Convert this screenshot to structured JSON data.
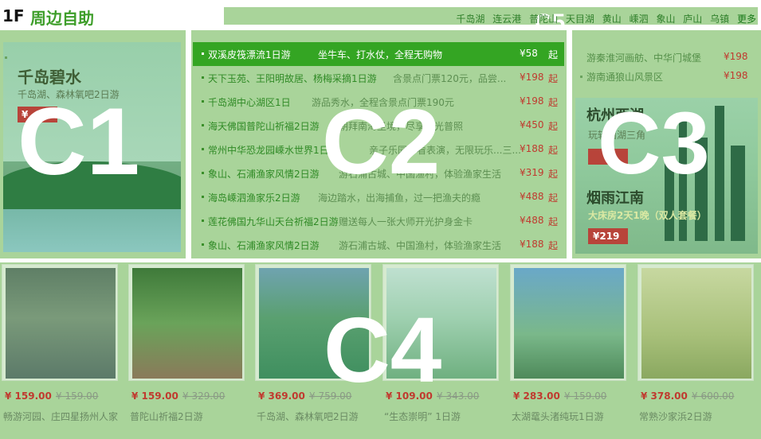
{
  "header": {
    "floor": "1F",
    "title": "周边自助",
    "c5_label": "C5",
    "links": [
      "千岛湖",
      "连云港",
      "普陀山",
      "天目湖",
      "黄山",
      "嵊泗",
      "象山",
      "庐山",
      "乌镇"
    ],
    "more": "更多"
  },
  "labels": {
    "c1": "C1",
    "c2": "C2",
    "c3": "C3",
    "c4": "C4"
  },
  "c1": {
    "title": "千岛碧水",
    "subtitle": "千岛湖、森林氧吧2日游",
    "price": "¥"
  },
  "c2": {
    "items": [
      {
        "name": "双溪皮筏漂流1日游",
        "desc": "坐牛车、打水仗，全程无购物",
        "price": "¥58",
        "qi": "起",
        "highlight": true
      },
      {
        "name": "天下玉苑、王阳明故居、杨梅采摘1日游",
        "desc": "含景点门票120元，品尝...",
        "price": "¥198",
        "qi": "起"
      },
      {
        "name": "千岛湖中心湖区1日",
        "desc": "游品秀水，全程含景点门票190元",
        "price": "¥198",
        "qi": "起"
      },
      {
        "name": "海天佛国普陀山祈福2日游",
        "desc": "朝拜南海圣境，尽享风光普照",
        "price": "¥450",
        "qi": "起"
      },
      {
        "name": "常州中华恐龙园嵊水世界1日游",
        "desc": "亲子乐园，看表演，无限玩乐...三...",
        "price": "¥188",
        "qi": "起"
      },
      {
        "name": "象山、石浦渔家风情2日游",
        "desc": "游石浦古城、中国渔村，体验渔家生活",
        "price": "¥319",
        "qi": "起"
      },
      {
        "name": "海岛嵊泗渔家乐2日游",
        "desc": "海边踏水，出海捕鱼，过一把渔夫的瘾",
        "price": "¥488",
        "qi": "起"
      },
      {
        "name": "莲花佛国九华山天台祈福2日游",
        "desc": "赠送每人一张大师开光护身金卡",
        "price": "¥488",
        "qi": "起"
      },
      {
        "name": "象山、石浦渔家风情2日游",
        "desc": "游石浦古城、中国渔村，体验渔家生活",
        "price": "¥188",
        "qi": "起"
      }
    ]
  },
  "c3": {
    "items": [
      {
        "name": "游秦淮河画舫、中华门城堡",
        "price": "¥198"
      },
      {
        "name": "游南通狼山风景区",
        "price": "¥198"
      }
    ],
    "promo1": {
      "title": "杭州西湖",
      "subtitle": "玩转西湖三角"
    },
    "promo2": {
      "title": "烟雨江南",
      "subtitle": "大床房2天1晚（双人套餐）",
      "price": "¥219"
    }
  },
  "c4": {
    "tiles": [
      {
        "price": "¥ 159.00",
        "old": "¥ 159.00",
        "name": "畅游河园、庄四星扬州人家"
      },
      {
        "price": "¥ 159.00",
        "old": "¥ 329.00",
        "name": "普陀山祈福2日游"
      },
      {
        "price": "¥ 369.00",
        "old": "¥ 759.00",
        "name": "千岛湖、森林氧吧2日游"
      },
      {
        "price": "¥ 109.00",
        "old": "¥ 343.00",
        "name": "“生态崇明” 1日游"
      },
      {
        "price": "¥ 283.00",
        "old": "¥ 159.00",
        "name": "太湖鼋头渚纯玩1日游"
      },
      {
        "price": "¥ 378.00",
        "old": "¥ 600.00",
        "name": "常熟沙家浜2日游"
      }
    ]
  }
}
